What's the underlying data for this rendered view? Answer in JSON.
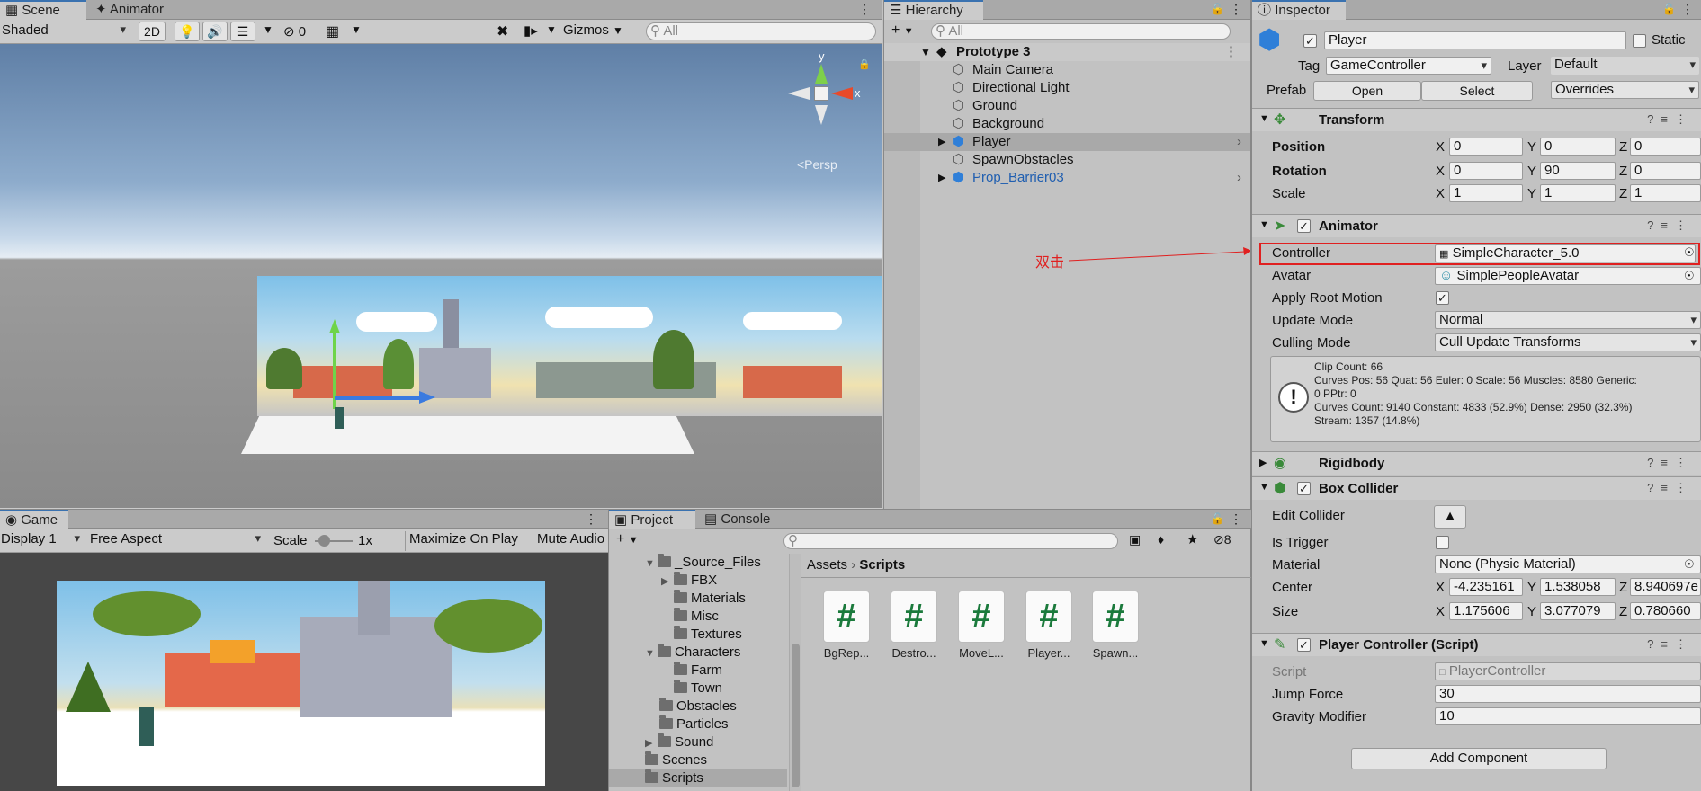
{
  "scene": {
    "tabs": [
      "Scene",
      "Animator"
    ],
    "shading": "Shaded",
    "btn_2d": "2D",
    "hidden_count": "0",
    "gizmos": "Gizmos",
    "search_placeholder": "All",
    "persp": "<Persp",
    "axis_x": "x",
    "axis_y": "y"
  },
  "hierarchy": {
    "tab": "Hierarchy",
    "search_placeholder": "All",
    "root": "Prototype 3",
    "items": [
      "Main Camera",
      "Directional Light",
      "Ground",
      "Background",
      "Player",
      "SpawnObstacles",
      "Prop_Barrier03"
    ]
  },
  "inspector": {
    "tab": "Inspector",
    "object_name": "Player",
    "static_label": "Static",
    "tag_label": "Tag",
    "tag_value": "GameController",
    "layer_label": "Layer",
    "layer_value": "Default",
    "prefab_label": "Prefab",
    "prefab_open": "Open",
    "prefab_select": "Select",
    "prefab_overrides": "Overrides",
    "transform": {
      "title": "Transform",
      "position_label": "Position",
      "rotation_label": "Rotation",
      "scale_label": "Scale",
      "position": [
        "0",
        "0",
        "0"
      ],
      "rotation": [
        "0",
        "90",
        "0"
      ],
      "scale": [
        "1",
        "1",
        "1"
      ]
    },
    "animator": {
      "title": "Animator",
      "controller_label": "Controller",
      "controller_value": "SimpleCharacter_5.0",
      "avatar_label": "Avatar",
      "avatar_value": "SimplePeopleAvatar",
      "root_motion_label": "Apply Root Motion",
      "update_mode_label": "Update Mode",
      "update_mode_value": "Normal",
      "culling_mode_label": "Culling Mode",
      "culling_mode_value": "Cull Update Transforms",
      "info_lines": [
        "Clip Count: 66",
        "Curves Pos: 56 Quat: 56 Euler: 0 Scale: 56 Muscles: 8580 Generic:",
        "0 PPtr: 0",
        "Curves Count: 9140 Constant: 4833 (52.9%) Dense: 2950 (32.3%)",
        "Stream: 1357 (14.8%)"
      ]
    },
    "rigidbody": {
      "title": "Rigidbody"
    },
    "box_collider": {
      "title": "Box Collider",
      "edit_collider_label": "Edit Collider",
      "is_trigger_label": "Is Trigger",
      "material_label": "Material",
      "material_value": "None (Physic Material)",
      "center_label": "Center",
      "center": [
        "-4.235161",
        "1.538058",
        "8.940697e"
      ],
      "size_label": "Size",
      "size": [
        "1.175606",
        "3.077079",
        "0.780660"
      ]
    },
    "player_controller": {
      "title": "Player Controller (Script)",
      "script_label": "Script",
      "script_value": "PlayerController",
      "jump_force_label": "Jump Force",
      "jump_force_value": "30",
      "gravity_label": "Gravity Modifier",
      "gravity_value": "10"
    },
    "add_component": "Add Component"
  },
  "annotation": {
    "text": "双击",
    "color": "#e02020"
  },
  "game": {
    "tab": "Game",
    "display": "Display 1",
    "aspect": "Free Aspect",
    "scale_label": "Scale",
    "scale_value": "1x",
    "maximize": "Maximize On Play",
    "mute": "Mute Audio"
  },
  "project": {
    "tabs": [
      "Project",
      "Console"
    ],
    "hidden_count": "8",
    "tree": [
      "_Source_Files",
      "FBX",
      "Materials",
      "Misc",
      "Textures",
      "Characters",
      "Farm",
      "Town",
      "Obstacles",
      "Particles",
      "Sound",
      "Scenes",
      "Scripts"
    ],
    "breadcrumb": [
      "Assets",
      "Scripts"
    ],
    "assets": [
      "BgRep...",
      "Destro...",
      "MoveL...",
      "Player...",
      "Spawn..."
    ]
  },
  "colors": {
    "accent": "#3a72b0",
    "highlight_red": "#e02020",
    "script_green": "#1b7a3c"
  }
}
